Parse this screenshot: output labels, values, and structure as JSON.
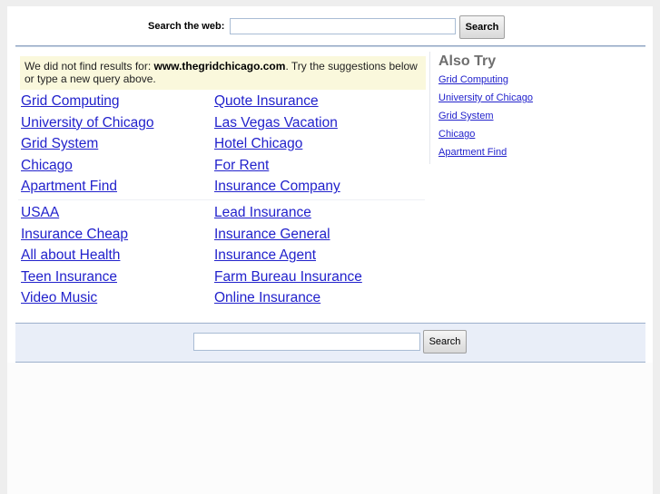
{
  "header": {
    "search_label": "Search the web:",
    "search_value": "",
    "search_button": "Search"
  },
  "notice": {
    "prefix": "We did not find results for: ",
    "domain": "www.thegridchicago.com",
    "suffix": ". Try the suggestions below or type a new query above."
  },
  "results": {
    "group1": {
      "left": [
        "Grid Computing",
        "University of Chicago",
        "Grid System",
        "Chicago",
        "Apartment Find"
      ],
      "right": [
        "Quote Insurance",
        "Las Vegas Vacation",
        "Hotel Chicago",
        "For Rent",
        "Insurance Company"
      ]
    },
    "group2": {
      "left": [
        "USAA",
        "Insurance Cheap",
        "All about Health",
        "Teen Insurance",
        "Video Music"
      ],
      "right": [
        "Lead Insurance",
        "Insurance General",
        "Insurance Agent",
        "Farm Bureau Insurance",
        "Online Insurance"
      ]
    }
  },
  "also_try": {
    "title": "Also Try",
    "items": [
      "Grid Computing",
      "University of Chicago",
      "Grid System",
      "Chicago",
      "Apartment Find"
    ]
  },
  "footer": {
    "search_value": "",
    "search_button": "Search"
  },
  "colors": {
    "link": "#2222cc",
    "notice_bg": "#faf8dc",
    "bar_bg": "#e9eef8",
    "rule": "#90a4c2"
  }
}
